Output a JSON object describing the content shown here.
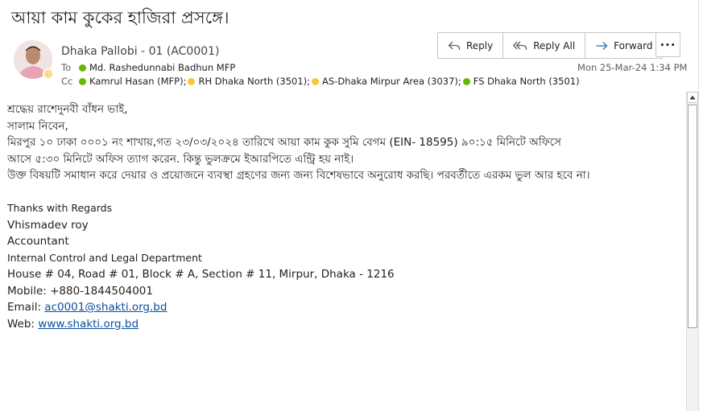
{
  "subject": "আয়া কাম কুকের হাজিরা প্রসঙ্গে।",
  "sender": {
    "name": "Dhaka Pallobi - 01 (AC0001)"
  },
  "to": {
    "label": "To",
    "recipients": [
      {
        "name": "Md. Rashedunnabi Badhun MFP",
        "status": "green"
      }
    ]
  },
  "cc": {
    "label": "Cc",
    "recipients": [
      {
        "name": "Kamrul Hasan (MFP);",
        "status": "green"
      },
      {
        "name": "RH  Dhaka North (3501);",
        "status": "yellow"
      },
      {
        "name": "AS-Dhaka  Mirpur Area (3037);",
        "status": "green"
      },
      {
        "name": "FS Dhaka North (3501)",
        "status": "green"
      }
    ]
  },
  "toolbar": {
    "reply": "Reply",
    "reply_all": "Reply All",
    "forward": "Forward",
    "more": "···"
  },
  "date": "Mon 25-Mar-24 1:34 PM",
  "body": {
    "greeting": "শ্রদ্ধেয় রাশেদুনবী বাঁধন ভাই,",
    "salutation": "সালাম নিবেন,",
    "line1": "মিরপুর ১০ ঢাকা ০০০১ নং শাখায়,গত ২৩/০৩/২০২৪ তারিখে  আয়া  কাম কুক  সুমি  বেগম (EIN- 18595) ৯০:১৫ মিনিটে অফিসে",
    "line2": "আসে   ৫:৩০ মিনিটে অফিস ত্যাগ করেন. কিন্তু ভুলক্রমে ইআরপিতে এন্ট্রি হয় নাই।",
    "line3": "উক্ত বিষয়টি সমাধান করে দেয়ার ও প্রয়োজনে ব্যবস্থা গ্রহণের জন্য  জন্য বিশেষভাবে অনুরোধ করছি। পরবর্তীতে এরকম ভুল আর হবে না।"
  },
  "signature": {
    "regards": "Thanks with Regards",
    "name": "Vhismadev roy",
    "title": "Accountant",
    "department": "Internal Control and Legal Department",
    "address": "House # 04, Road # 01, Block # A, Section # 11, Mirpur, Dhaka - 1216",
    "mobile": "Mobile: +880-1844504001",
    "email_label": "Email: ",
    "email": "ac0001@shakti.org.bd",
    "web_label": "Web: ",
    "web": "www.shakti.org.bd"
  },
  "colors": {
    "link": "#0b4f9c",
    "presence_green": "#6bb700",
    "presence_away": "#f8c73c"
  }
}
